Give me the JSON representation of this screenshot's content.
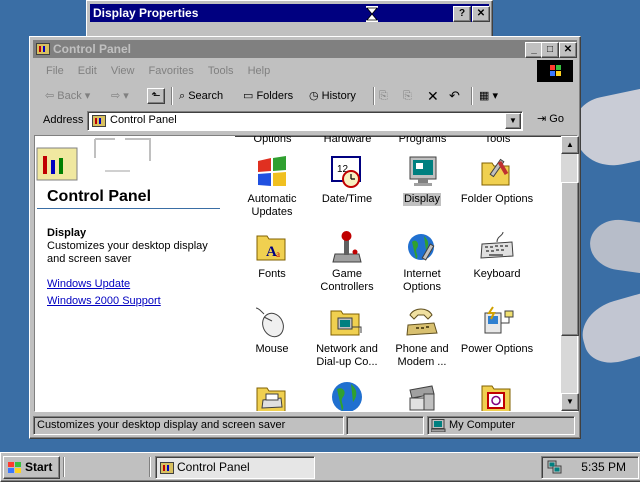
{
  "display_window": {
    "title": "Display Properties",
    "help_glyph": "?",
    "close_glyph": "✕"
  },
  "cp_window": {
    "title": "Control Panel"
  },
  "menu": [
    "File",
    "Edit",
    "View",
    "Favorites",
    "Tools",
    "Help"
  ],
  "toolbar": {
    "back": "Back",
    "search": "Search",
    "folders": "Folders",
    "history": "History"
  },
  "address": {
    "label": "Address",
    "value": "Control Panel",
    "go": "Go"
  },
  "left_panel": {
    "title": "Control Panel",
    "selected_name": "Display",
    "selected_desc": "Customizes your desktop display and screen saver",
    "links": [
      "Windows Update",
      "Windows 2000 Support"
    ]
  },
  "partial_labels": [
    "Options",
    "Hardware",
    "Programs",
    "Tools"
  ],
  "items": [
    {
      "label": "Automatic Updates",
      "icon": "automatic-updates-icon"
    },
    {
      "label": "Date/Time",
      "icon": "date-time-icon"
    },
    {
      "label": "Display",
      "icon": "display-icon",
      "selected": true
    },
    {
      "label": "Folder Options",
      "icon": "folder-options-icon"
    },
    {
      "label": "Fonts",
      "icon": "fonts-icon"
    },
    {
      "label": "Game Controllers",
      "icon": "game-controllers-icon"
    },
    {
      "label": "Internet Options",
      "icon": "internet-options-icon"
    },
    {
      "label": "Keyboard",
      "icon": "keyboard-icon"
    },
    {
      "label": "Mouse",
      "icon": "mouse-icon"
    },
    {
      "label": "Network and Dial-up Co...",
      "icon": "network-icon"
    },
    {
      "label": "Phone and Modem ...",
      "icon": "phone-modem-icon"
    },
    {
      "label": "Power Options",
      "icon": "power-options-icon"
    }
  ],
  "status": {
    "text": "Customizes your desktop display and screen saver",
    "zone": "My Computer"
  },
  "taskbar": {
    "start": "Start",
    "task": "Control Panel",
    "time": "5:35 PM"
  }
}
